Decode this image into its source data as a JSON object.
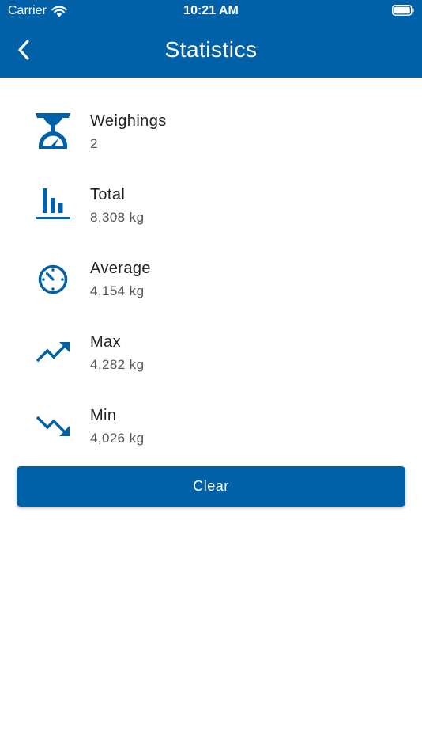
{
  "status_bar": {
    "carrier": "Carrier",
    "time": "10:21 AM"
  },
  "header": {
    "title": "Statistics",
    "back_icon": "chevron-left-icon"
  },
  "stats": [
    {
      "icon": "scale-icon",
      "label": "Weighings",
      "value": "2"
    },
    {
      "icon": "bar-chart-icon",
      "label": "Total",
      "value": "8,308 kg"
    },
    {
      "icon": "gauge-icon",
      "label": "Average",
      "value": "4,154 kg"
    },
    {
      "icon": "trending-up-icon",
      "label": "Max",
      "value": "4,282 kg"
    },
    {
      "icon": "trending-down-icon",
      "label": "Min",
      "value": "4,026 kg"
    }
  ],
  "actions": {
    "clear_label": "Clear"
  },
  "colors": {
    "primary": "#0061a8",
    "text_primary": "#212121",
    "text_secondary": "#555555",
    "background": "#ffffff"
  }
}
